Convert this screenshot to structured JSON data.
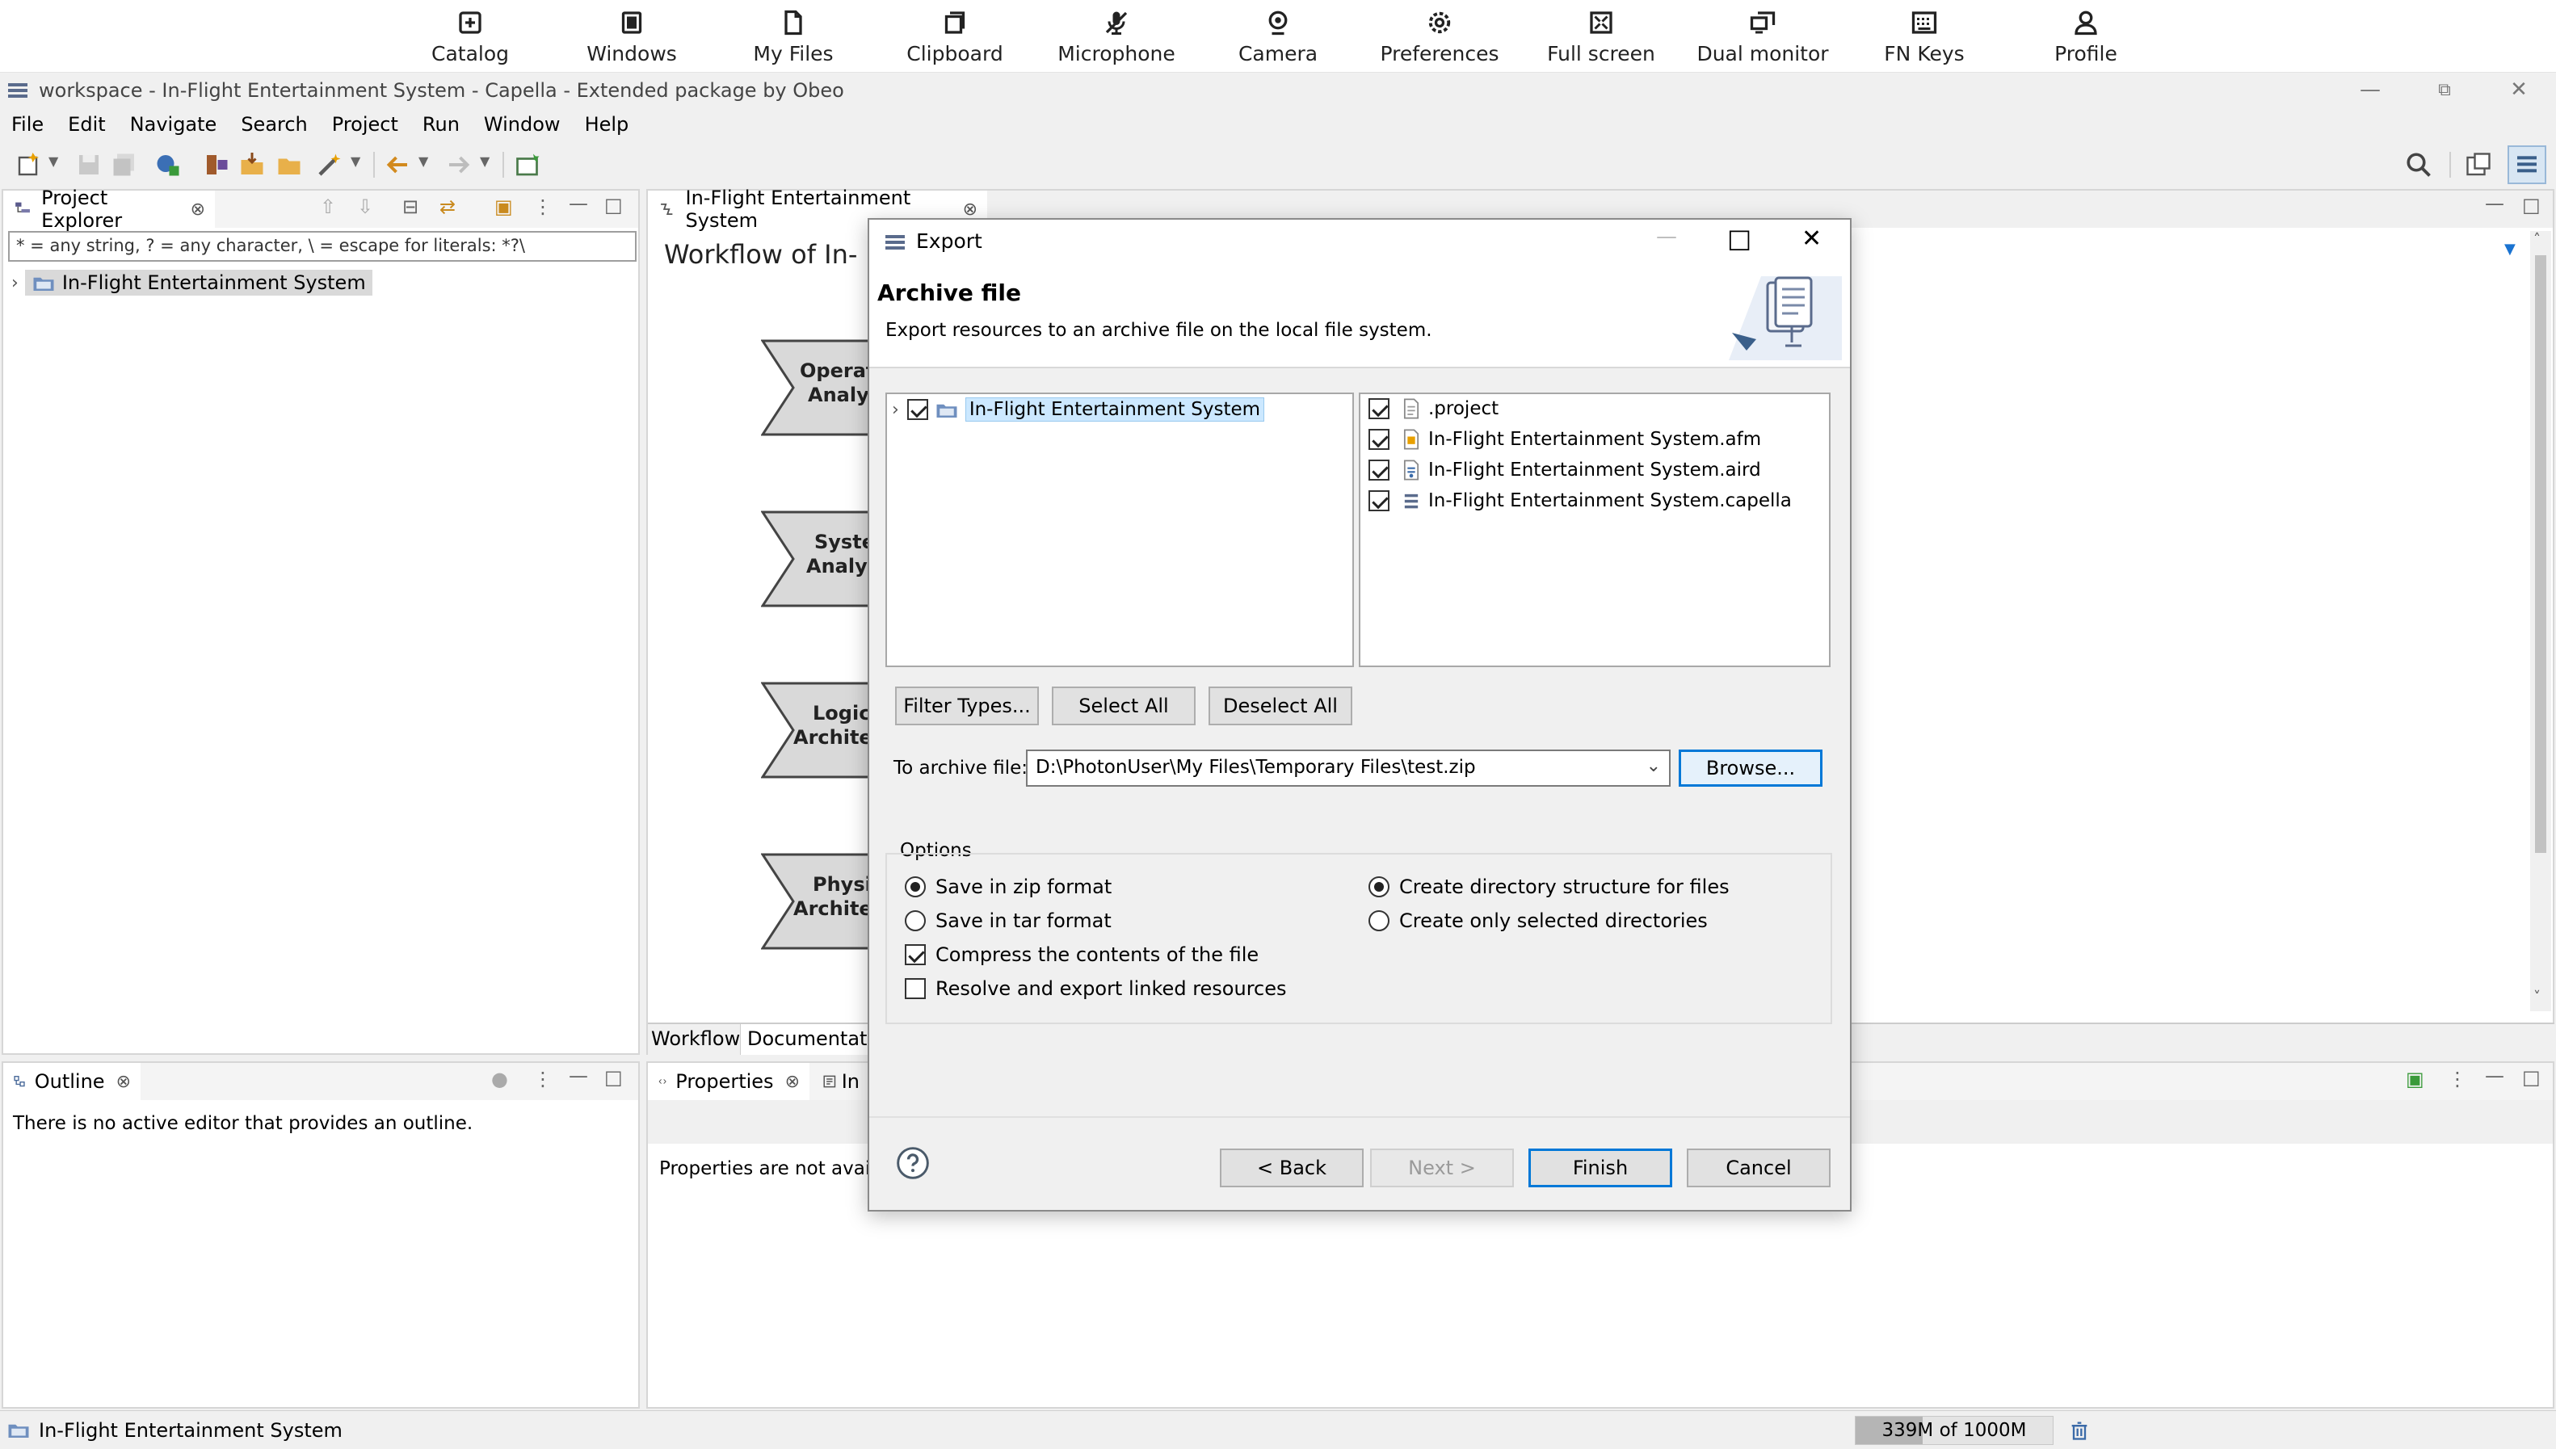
{
  "stream_bar": [
    {
      "label": "Catalog",
      "icon": "plus-square-icon"
    },
    {
      "label": "Windows",
      "icon": "window-icon"
    },
    {
      "label": "My Files",
      "icon": "file-icon"
    },
    {
      "label": "Clipboard",
      "icon": "clipboard-icon"
    },
    {
      "label": "Microphone",
      "icon": "microphone-off-icon"
    },
    {
      "label": "Camera",
      "icon": "camera-icon"
    },
    {
      "label": "Preferences",
      "icon": "gear-icon"
    },
    {
      "label": "Full screen",
      "icon": "fullscreen-icon"
    },
    {
      "label": "Dual monitor",
      "icon": "dual-monitor-icon"
    },
    {
      "label": "FN Keys",
      "icon": "keyboard-icon"
    },
    {
      "label": "Profile",
      "icon": "user-icon"
    }
  ],
  "window": {
    "title": "workspace - In-Flight Entertainment System - Capella - Extended package by Obeo"
  },
  "menu": [
    "File",
    "Edit",
    "Navigate",
    "Search",
    "Project",
    "Run",
    "Window",
    "Help"
  ],
  "project_explorer": {
    "tab_label": "Project Explorer",
    "filter_text": "* = any string, ? = any character, \\ = escape for literals: *?\\",
    "tree_item": "In-Flight Entertainment System"
  },
  "editor": {
    "tab_label": "In-Flight Entertainment System",
    "heading": "Workflow of In-",
    "steps": [
      "Operat",
      "Analy",
      "Syste",
      "Analy",
      "Logic",
      "Archite",
      "Physi",
      "Archite"
    ],
    "bottom_tabs": [
      "Workflow",
      "Documentatic"
    ]
  },
  "outline": {
    "tab_label": "Outline",
    "message": "There is no active editor that provides an outline."
  },
  "properties": {
    "tab_label": "Properties",
    "second_tab": "In",
    "message": "Properties are not availab"
  },
  "status_bar": {
    "left_text": "In-Flight Entertainment System",
    "heap_text": "339M of 1000M",
    "heap_fraction": 0.339
  },
  "dialog": {
    "title": "Export",
    "banner_title": "Archive file",
    "banner_desc": "Export resources to an archive file on the local file system.",
    "left_tree_item": "In-Flight Entertainment System",
    "files": [
      {
        "name": ".project",
        "checked": true
      },
      {
        "name": "In-Flight Entertainment System.afm",
        "checked": true
      },
      {
        "name": "In-Flight Entertainment System.aird",
        "checked": true
      },
      {
        "name": "In-Flight Entertainment System.capella",
        "checked": true
      }
    ],
    "filter_types_label": "Filter Types...",
    "select_all_label": "Select All",
    "deselect_all_label": "Deselect All",
    "to_archive_label": "To archive file:",
    "archive_path": "D:\\PhotonUser\\My Files\\Temporary Files\\test.zip",
    "browse_label": "Browse...",
    "options_label": "Options",
    "opt_zip": "Save in zip format",
    "opt_tar": "Save in tar format",
    "opt_compress": "Compress the contents of the file",
    "opt_resolve": "Resolve and export linked resources",
    "opt_dir_struct": "Create directory structure for files",
    "opt_only_selected": "Create only selected directories",
    "back_label": "< Back",
    "next_label": "Next >",
    "finish_label": "Finish",
    "cancel_label": "Cancel"
  },
  "colors": {
    "accent": "#0078d7",
    "selection": "#cce8ff",
    "heap_fill": "#b5b5b5"
  }
}
